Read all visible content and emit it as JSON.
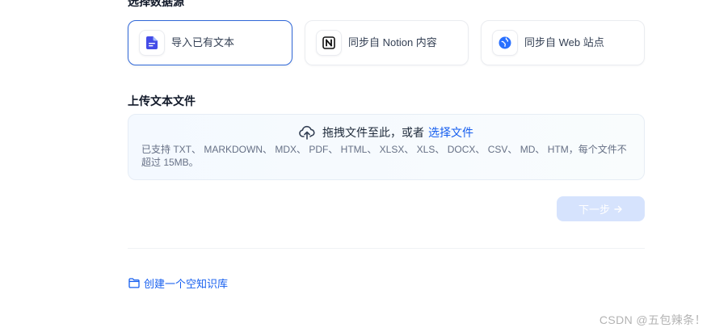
{
  "data_source": {
    "title": "选择数据源",
    "options": [
      {
        "label": "导入已有文本",
        "icon": "document-icon",
        "selected": true
      },
      {
        "label": "同步自 Notion 内容",
        "icon": "notion-icon",
        "selected": false
      },
      {
        "label": "同步自 Web 站点",
        "icon": "globe-icon",
        "selected": false
      }
    ]
  },
  "upload": {
    "title": "上传文本文件",
    "icon": "cloud-upload-icon",
    "drop_text": "拖拽文件至此，或者",
    "browse_link": "选择文件",
    "supported_tip": "已支持 TXT、 MARKDOWN、 MDX、 PDF、 HTML、 XLSX、 XLS、 DOCX、 CSV、 MD、 HTM，每个文件不超过 15MB。"
  },
  "actions": {
    "next_label": "下一步",
    "next_icon": "arrow-right-icon",
    "next_disabled": true
  },
  "footer": {
    "create_empty_label": "创建一个空知识库",
    "create_empty_icon": "folder-icon"
  },
  "watermark": "CSDN @五包辣条！",
  "colors": {
    "accent": "#155eef",
    "selected_border": "#2f67d8",
    "card_border": "#eaecf0",
    "dropzone_bg": "#f4f9ff",
    "dropzone_border": "#e6edf5",
    "button_disabled_bg": "#d6e3fd",
    "text_primary": "#101828",
    "text_secondary": "#667085",
    "watermark": "#b3b3b3"
  }
}
